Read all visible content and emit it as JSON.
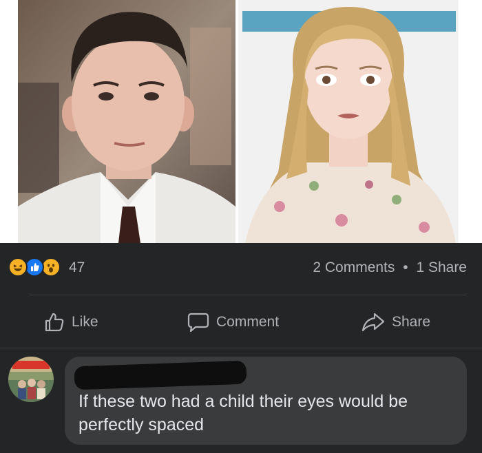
{
  "post": {
    "reactions": {
      "icons": [
        "laugh-reaction-icon",
        "like-reaction-icon",
        "wow-reaction-icon"
      ],
      "count": "47"
    },
    "comments_label": "2 Comments",
    "separator": "•",
    "shares_label": "1 Share"
  },
  "actions": {
    "like_label": "Like",
    "comment_label": "Comment",
    "share_label": "Share"
  },
  "comment": {
    "text": "If these two had a child their eyes would be perfectly spaced"
  },
  "colors": {
    "background": "#242526",
    "bubble": "#3a3b3c",
    "secondary_text": "#b0b3b8",
    "primary_text": "#e4e6eb",
    "like_blue": "#1877f2",
    "reaction_yellow": "#f7b125"
  }
}
